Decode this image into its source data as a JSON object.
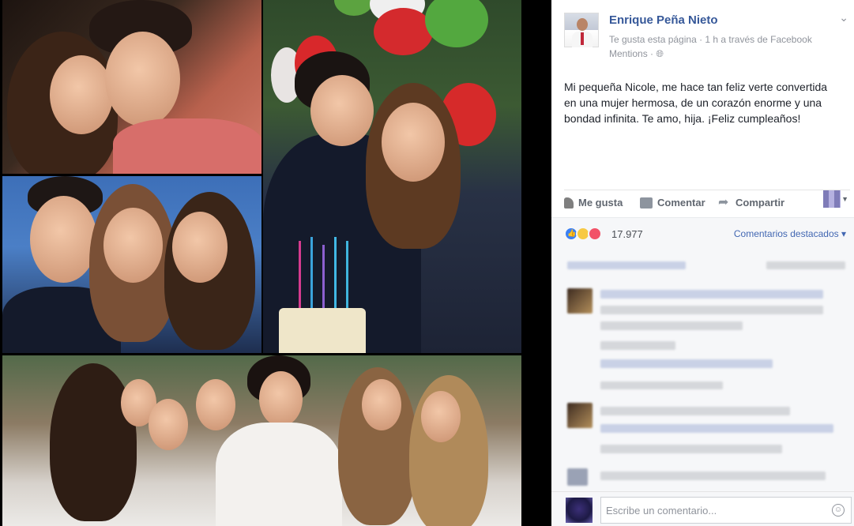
{
  "post": {
    "page_name": "Enrique Peña Nieto",
    "meta_line1": "Te gusta esta página · 1 h a través de Facebook",
    "meta_line2": "Mentions · ",
    "globe_icon": "globe-icon",
    "text": "Mi pequeña Nicole, me hace tan feliz verte convertida en una mujer hermosa, de un corazón enorme y una bondad infinita. Te amo, hija. ¡Feliz cumpleaños!"
  },
  "actions": {
    "like": "Me gusta",
    "comment": "Comentar",
    "share": "Compartir"
  },
  "reactions": {
    "count": "17.977",
    "types": [
      "like",
      "haha",
      "love"
    ],
    "top_comments": "Comentarios destacados"
  },
  "composer": {
    "placeholder": "Escribe un comentario..."
  },
  "colors": {
    "link": "#365899",
    "accent": "#4267b2",
    "like": "#3b80f5",
    "love": "#f25268",
    "haha": "#f7c944"
  }
}
